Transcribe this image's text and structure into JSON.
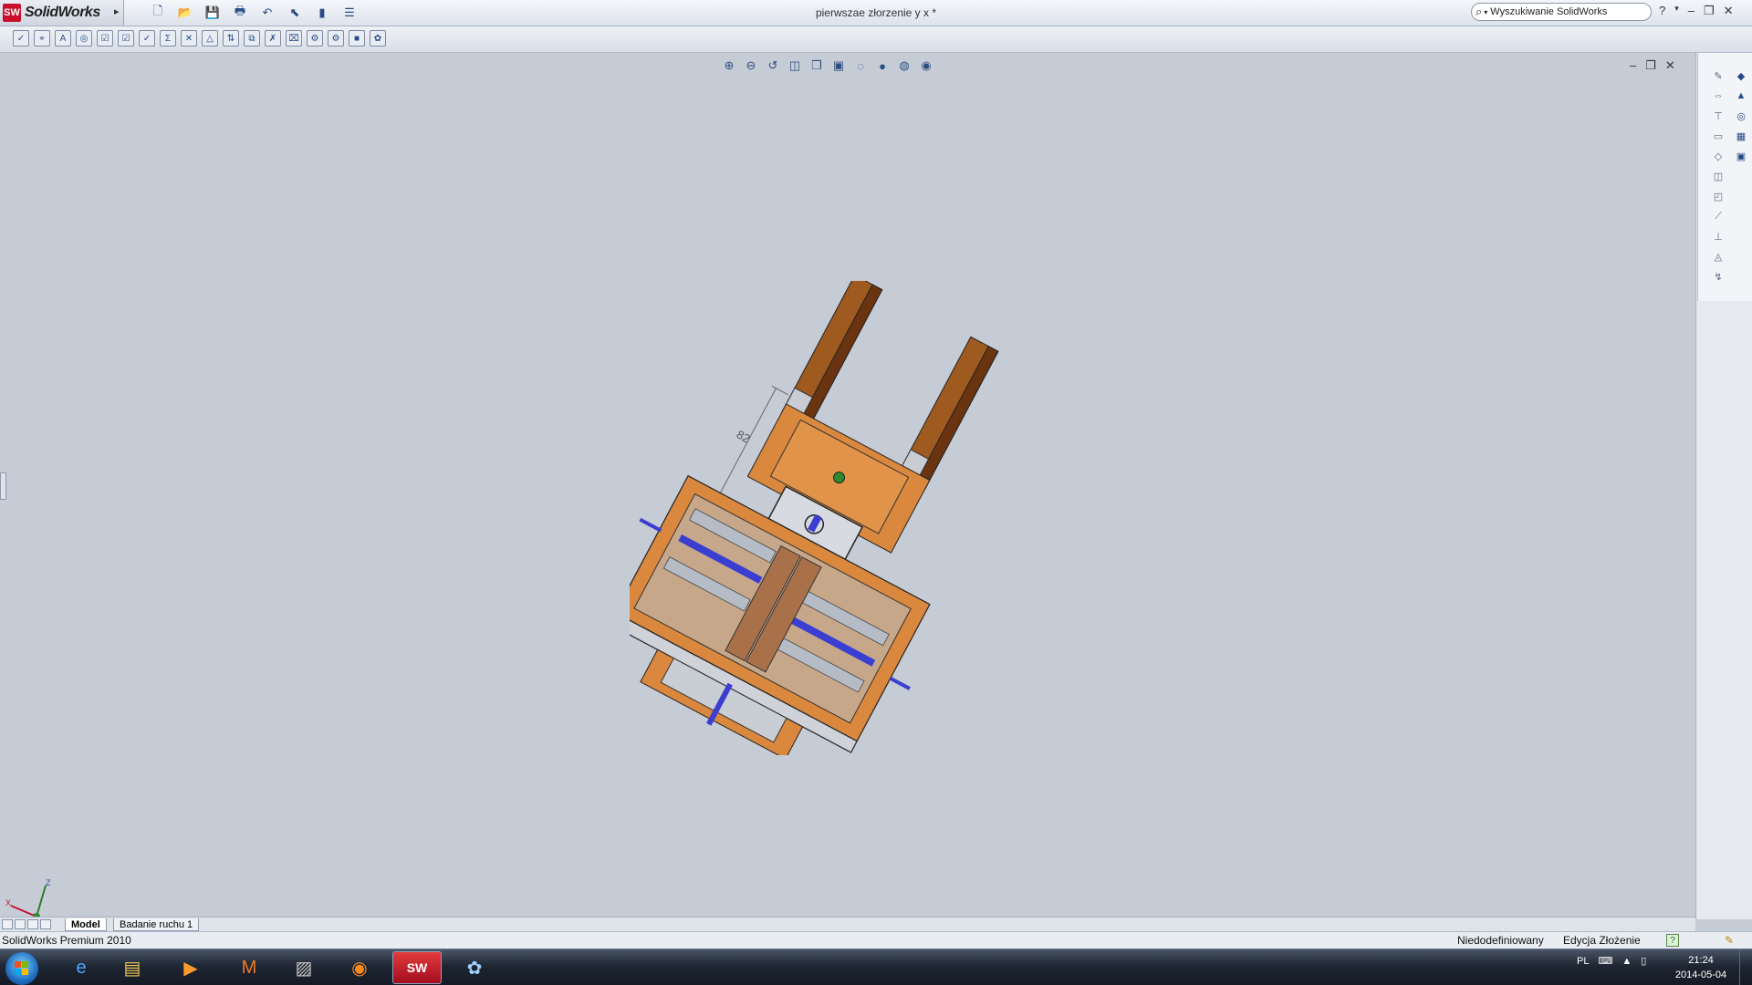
{
  "app": {
    "logo_badge": "SW",
    "logo_text": "SolidWorks",
    "document_title": "pierwszae złorzenie y x *",
    "search_placeholder": "Wyszukiwanie SolidWorks",
    "help_label": "?"
  },
  "window_controls": [
    "–",
    "❐",
    "✕"
  ],
  "quick_access": [
    {
      "name": "new-icon",
      "glyph": "🗋"
    },
    {
      "name": "open-icon",
      "glyph": "📂"
    },
    {
      "name": "save-icon",
      "glyph": "💾"
    },
    {
      "name": "print-icon",
      "glyph": "🖶"
    },
    {
      "name": "undo-icon",
      "glyph": "↶"
    },
    {
      "name": "select-icon",
      "glyph": "⬉"
    },
    {
      "name": "rebuild-icon",
      "glyph": "▮"
    },
    {
      "name": "options-icon",
      "glyph": "☰"
    }
  ],
  "command_tools": [
    {
      "name": "spellcheck-icon",
      "glyph": "✓"
    },
    {
      "name": "measure-icon",
      "glyph": "⌖"
    },
    {
      "name": "text-icon",
      "glyph": "A"
    },
    {
      "name": "balloon-icon",
      "glyph": "◎"
    },
    {
      "name": "check-icon",
      "glyph": "☑"
    },
    {
      "name": "check2-icon",
      "glyph": "☑"
    },
    {
      "name": "check3-icon",
      "glyph": "✓"
    },
    {
      "name": "sum-icon",
      "glyph": "Σ"
    },
    {
      "name": "mass-icon",
      "glyph": "✕"
    },
    {
      "name": "section-icon",
      "glyph": "△"
    },
    {
      "name": "symmetry-icon",
      "glyph": "⇅"
    },
    {
      "name": "compare-icon",
      "glyph": "⧉"
    },
    {
      "name": "interference-icon",
      "glyph": "✗"
    },
    {
      "name": "hole-icon",
      "glyph": "⌧"
    },
    {
      "name": "mate-icon",
      "glyph": "⚙"
    },
    {
      "name": "configure-icon",
      "glyph": "⚙"
    },
    {
      "name": "stop-icon",
      "glyph": "■"
    },
    {
      "name": "palette-icon",
      "glyph": "✿"
    }
  ],
  "view_tools": [
    {
      "name": "zoom-fit-icon",
      "glyph": "⊕"
    },
    {
      "name": "zoom-area-icon",
      "glyph": "⊖"
    },
    {
      "name": "previous-view-icon",
      "glyph": "↺"
    },
    {
      "name": "section-view-icon",
      "glyph": "◫"
    },
    {
      "name": "view-orientation-icon",
      "glyph": "❒"
    },
    {
      "name": "display-style-icon",
      "glyph": "▣"
    },
    {
      "name": "hide-show-icon",
      "glyph": "◌"
    },
    {
      "name": "appearance-icon",
      "glyph": "●"
    },
    {
      "name": "scene-icon",
      "glyph": "◍"
    },
    {
      "name": "realview-icon",
      "glyph": "◉"
    }
  ],
  "doc_controls": [
    "–",
    "❐",
    "✕"
  ],
  "model": {
    "dimension_label": "82",
    "colors": {
      "wood": "#d9883e",
      "wood_dark": "#7a3f12",
      "plate": "#9aa7b5",
      "rod_blue": "#3a3fd1"
    }
  },
  "triad": {
    "x_label": "X",
    "z_label": "Z"
  },
  "task_pane_icons": [
    {
      "name": "home-icon",
      "glyph": "⌂"
    },
    {
      "name": "design-library-icon",
      "glyph": "▤"
    },
    {
      "name": "file-explorer-icon",
      "glyph": "📁"
    },
    {
      "name": "search-results-icon",
      "glyph": "◉"
    },
    {
      "name": "view-palette-icon",
      "glyph": "▦"
    },
    {
      "name": "appearances-icon",
      "glyph": "●"
    },
    {
      "name": "custom-properties-icon",
      "glyph": "☰"
    }
  ],
  "side_tools": [
    {
      "name": "sketch-icon",
      "glyph": "✎"
    },
    {
      "name": "smart-dimension-icon",
      "glyph": "⇔"
    },
    {
      "name": "line-icon",
      "glyph": "⊤"
    },
    {
      "name": "rectangle-icon",
      "glyph": "▭"
    },
    {
      "name": "circle-icon",
      "glyph": "◇"
    },
    {
      "name": "arc-icon",
      "glyph": "◫"
    },
    {
      "name": "spline-icon",
      "glyph": "◰"
    },
    {
      "name": "trim-icon",
      "glyph": "⟋"
    },
    {
      "name": "offset-icon",
      "glyph": "⊥"
    },
    {
      "name": "mirror-icon",
      "glyph": "◬"
    },
    {
      "name": "relations-icon",
      "glyph": "↯"
    }
  ],
  "side_tools_right": [
    {
      "name": "extrude-icon",
      "glyph": "◆"
    },
    {
      "name": "revolve-icon",
      "glyph": "▲"
    },
    {
      "name": "fillet-icon",
      "glyph": "◎"
    },
    {
      "name": "pattern-icon",
      "glyph": "▦"
    },
    {
      "name": "shell-icon",
      "glyph": "▣"
    }
  ],
  "tabs": [
    {
      "label": "Model",
      "active": true
    },
    {
      "label": "Badanie ruchu 1",
      "active": false
    }
  ],
  "status": {
    "product": "SolidWorks Premium 2010",
    "definition": "Niedodefiniowany",
    "mode": "Edycja Złożenie",
    "help": "?"
  },
  "taskbar": {
    "apps": [
      {
        "name": "internet-explorer-icon",
        "glyph": "e",
        "color": "#4aa8ff"
      },
      {
        "name": "explorer-icon",
        "glyph": "▤",
        "color": "#f3c85a"
      },
      {
        "name": "media-player-icon",
        "glyph": "▶",
        "color": "#ff9a2e"
      },
      {
        "name": "matlab-icon",
        "glyph": "M",
        "color": "#f07a1f"
      },
      {
        "name": "app-icon",
        "glyph": "▨",
        "color": "#c9c9c9"
      },
      {
        "name": "firefox-icon",
        "glyph": "◉",
        "color": "#ff8a1e"
      },
      {
        "name": "solidworks-icon",
        "glyph": "SW",
        "color": "#ffffff"
      },
      {
        "name": "paint-icon",
        "glyph": "✿",
        "color": "#9fd1ff"
      }
    ],
    "language": "PL",
    "time": "21:24",
    "date": "2014-05-04"
  }
}
